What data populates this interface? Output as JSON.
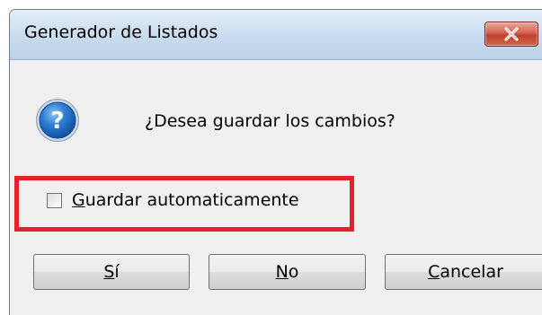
{
  "window": {
    "title": "Generador de Listados"
  },
  "titlebar": {
    "close_icon": "close-icon"
  },
  "dialog": {
    "icon": "question-icon",
    "message": "¿Desea guardar los cambios?",
    "checkbox": {
      "label_mnemonic": "G",
      "label_rest": "uardar automaticamente",
      "checked": false
    },
    "highlight_color": "#e8202e"
  },
  "buttons": {
    "yes": {
      "mnemonic": "S",
      "rest": "í"
    },
    "no": {
      "mnemonic": "N",
      "rest": "o"
    },
    "cancel": {
      "mnemonic": "C",
      "rest": "ancelar"
    }
  }
}
